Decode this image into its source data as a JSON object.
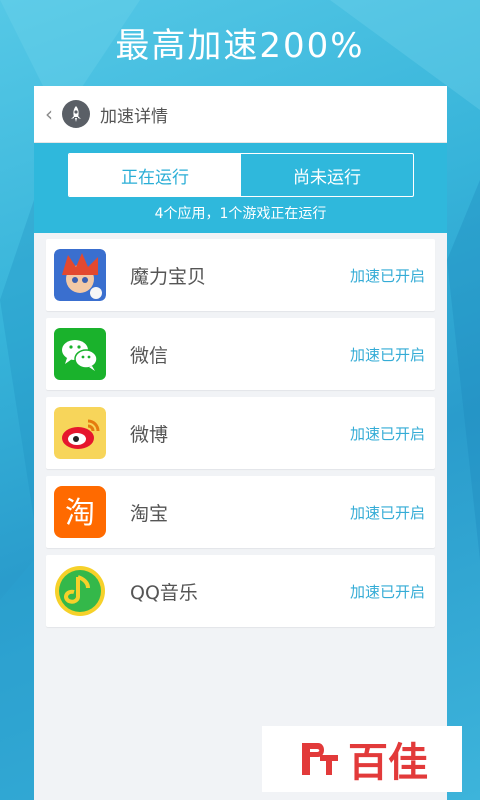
{
  "headline": "最高加速200%",
  "topbar": {
    "back_icon": "chevron-left-icon",
    "logo_icon": "rocket-icon",
    "title": "加速详情"
  },
  "tabs": [
    {
      "label": "正在运行",
      "active": true
    },
    {
      "label": "尚未运行",
      "active": false
    }
  ],
  "summary": "4个应用，1个游戏正在运行",
  "apps": [
    {
      "name": "魔力宝贝",
      "status": "加速已开启",
      "icon": "mlbb-game-icon"
    },
    {
      "name": "微信",
      "status": "加速已开启",
      "icon": "wechat-icon"
    },
    {
      "name": "微博",
      "status": "加速已开启",
      "icon": "weibo-icon"
    },
    {
      "name": "淘宝",
      "status": "加速已开启",
      "icon": "taobao-icon"
    },
    {
      "name": "QQ音乐",
      "status": "加速已开启",
      "icon": "qq-music-icon"
    }
  ],
  "watermark": "百佳",
  "colors": {
    "accent": "#2fb8dc",
    "status_text": "#35acd6",
    "watermark": "#e23a3a"
  }
}
